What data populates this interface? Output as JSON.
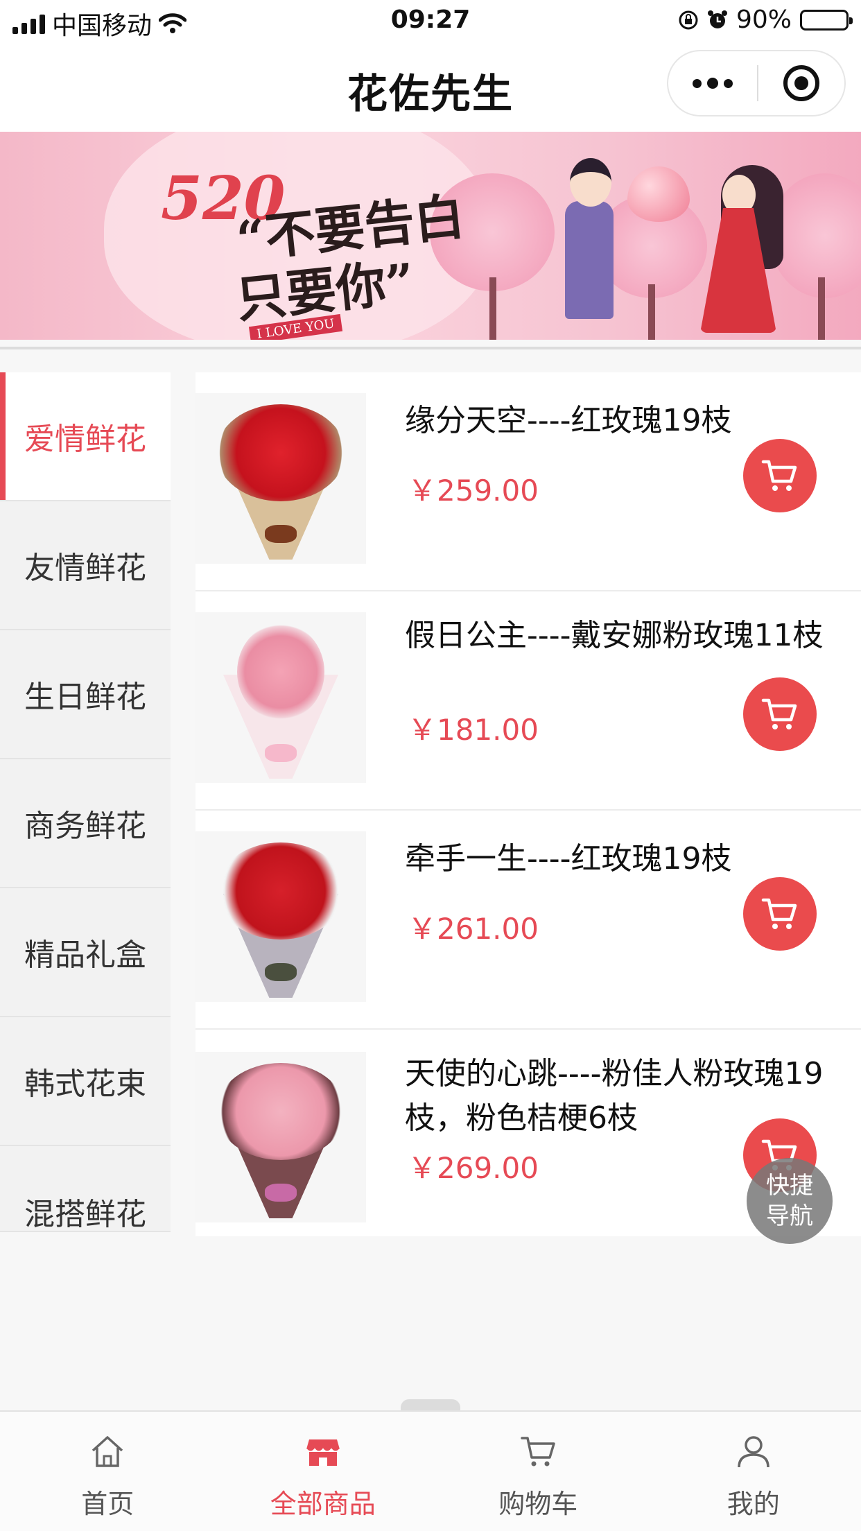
{
  "status_bar": {
    "carrier": "中国移动",
    "time": "09:27",
    "battery": "90%",
    "battery_level": 0.9,
    "icons": [
      "signal-icon",
      "wifi-icon",
      "rotation-lock-icon",
      "alarm-icon",
      "battery-icon"
    ]
  },
  "nav": {
    "title": "花佐先生",
    "icons": [
      "more-icon",
      "close-miniprogram-icon"
    ]
  },
  "banner": {
    "number": "520",
    "slogan_line1": "“不要告白",
    "slogan_line2": "只要你”",
    "tag": "I LOVE YOU"
  },
  "categories": [
    {
      "label": "爱情鲜花",
      "active": true
    },
    {
      "label": "友情鲜花",
      "active": false
    },
    {
      "label": "生日鲜花",
      "active": false
    },
    {
      "label": "商务鲜花",
      "active": false
    },
    {
      "label": "精品礼盒",
      "active": false
    },
    {
      "label": "韩式花束",
      "active": false
    },
    {
      "label": "混搭鲜花",
      "active": false
    }
  ],
  "products": [
    {
      "name": "缘分天空----红玫瑰19枝",
      "price": "￥259.00",
      "image": "red-rose-bouquet"
    },
    {
      "name": "假日公主----戴安娜粉玫瑰11枝",
      "price": "￥181.00",
      "image": "pink-rose-bouquet"
    },
    {
      "name": "牵手一生----红玫瑰19枝",
      "price": "￥261.00",
      "image": "red-rose-gray-wrap-bouquet"
    },
    {
      "name": "天使的心跳----粉佳人粉玫瑰19枝，粉色桔梗6枝",
      "price": "￥269.00",
      "image": "pink-rose-mixed-bouquet"
    }
  ],
  "quick_nav": {
    "line1": "快捷",
    "line2": "导航"
  },
  "tabs": [
    {
      "label": "首页",
      "icon": "home-icon",
      "active": false
    },
    {
      "label": "全部商品",
      "icon": "store-icon",
      "active": true
    },
    {
      "label": "购物车",
      "icon": "cart-icon",
      "active": false
    },
    {
      "label": "我的",
      "icon": "user-icon",
      "active": false
    }
  ],
  "colors": {
    "accent": "#e64a55",
    "cart_button": "#ea4b4d"
  }
}
